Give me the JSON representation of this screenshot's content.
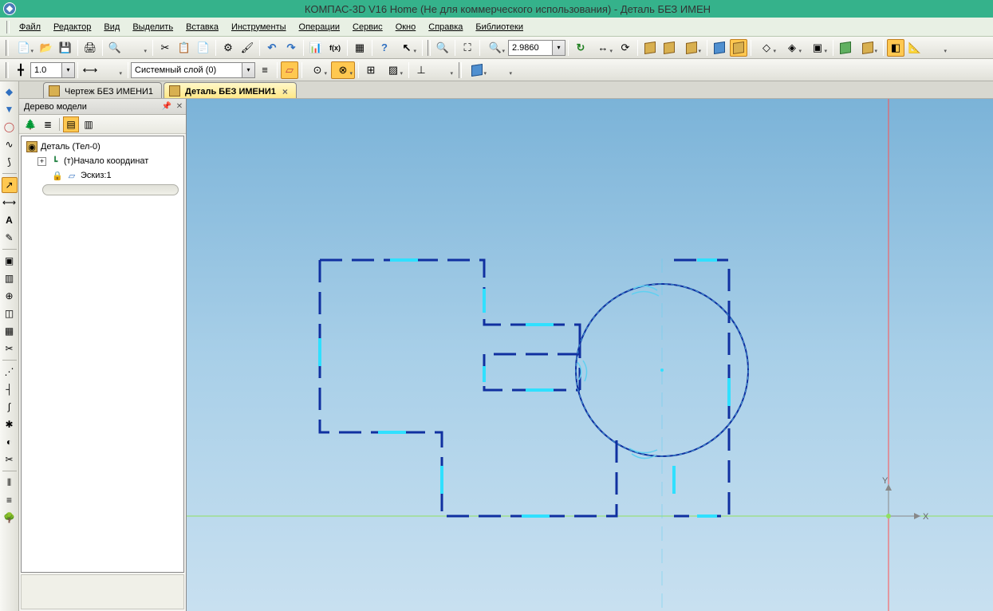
{
  "app": {
    "title": "КОМПАС-3D V16 Home  (Не для коммерческого использования) - Деталь БЕЗ ИМЕН"
  },
  "menu": {
    "file": "Файл",
    "edit": "Редактор",
    "view": "Вид",
    "select": "Выделить",
    "insert": "Вставка",
    "tools": "Инструменты",
    "operations": "Операции",
    "service": "Сервис",
    "window": "Окно",
    "help": "Справка",
    "libraries": "Библиотеки"
  },
  "toolbar1": {
    "zoom_value": "2.9860"
  },
  "toolbar2": {
    "scale_value": "1.0",
    "layer_value": "Системный слой (0)"
  },
  "tabs": {
    "tab1": "Чертеж БЕЗ ИМЕНИ1",
    "tab2": "Деталь БЕЗ ИМЕНИ1",
    "close": "×"
  },
  "tree": {
    "title": "Дерево модели",
    "root": "Деталь (Тел-0)",
    "origin": "(т)Начало координат",
    "sketch": "Эскиз:1"
  },
  "axes": {
    "x": "X",
    "y": "Y"
  }
}
